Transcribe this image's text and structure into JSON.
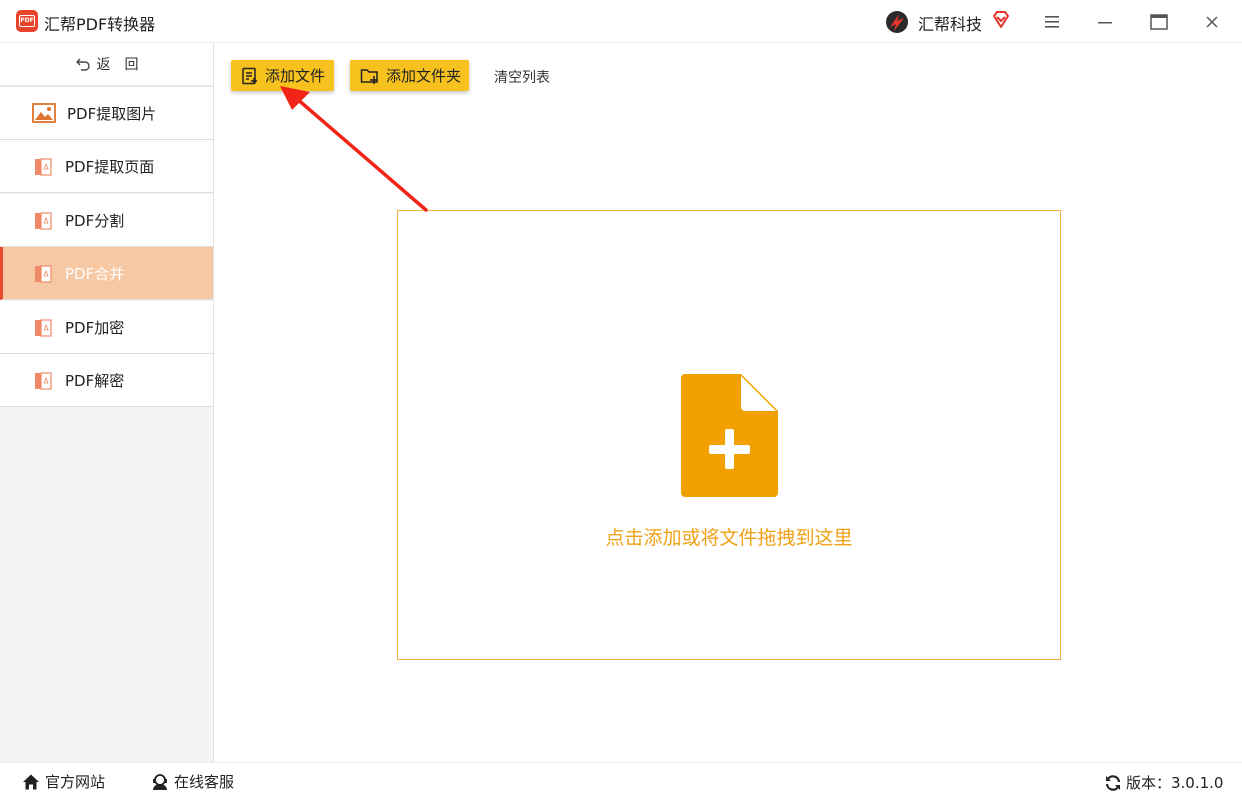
{
  "app": {
    "title": "汇帮PDF转换器",
    "brand": "汇帮科技"
  },
  "colors": {
    "accent": "#f7c21d",
    "active_bg": "#f7c8a4",
    "active_bar": "#ea4a2c",
    "drop_border": "#f4b13f",
    "drop_text": "#f0a116",
    "logo_red": "#e8442c"
  },
  "sidebar": {
    "back_label": "返回",
    "items": [
      {
        "label": "PDF提取图片",
        "icon": "image-icon",
        "active": false
      },
      {
        "label": "PDF提取页面",
        "icon": "pdf-file-icon",
        "active": false
      },
      {
        "label": "PDF分割",
        "icon": "pdf-file-icon",
        "active": false
      },
      {
        "label": "PDF合并",
        "icon": "pdf-file-icon",
        "active": true
      },
      {
        "label": "PDF加密",
        "icon": "pdf-file-icon",
        "active": false
      },
      {
        "label": "PDF解密",
        "icon": "pdf-file-icon",
        "active": false
      }
    ]
  },
  "toolbar": {
    "add_file": "添加文件",
    "add_folder": "添加文件夹",
    "clear_list": "清空列表"
  },
  "dropzone": {
    "text": "点击添加或将文件拖拽到这里"
  },
  "footer": {
    "website": "官方网站",
    "support": "在线客服",
    "version": "版本：3.0.1.0"
  }
}
